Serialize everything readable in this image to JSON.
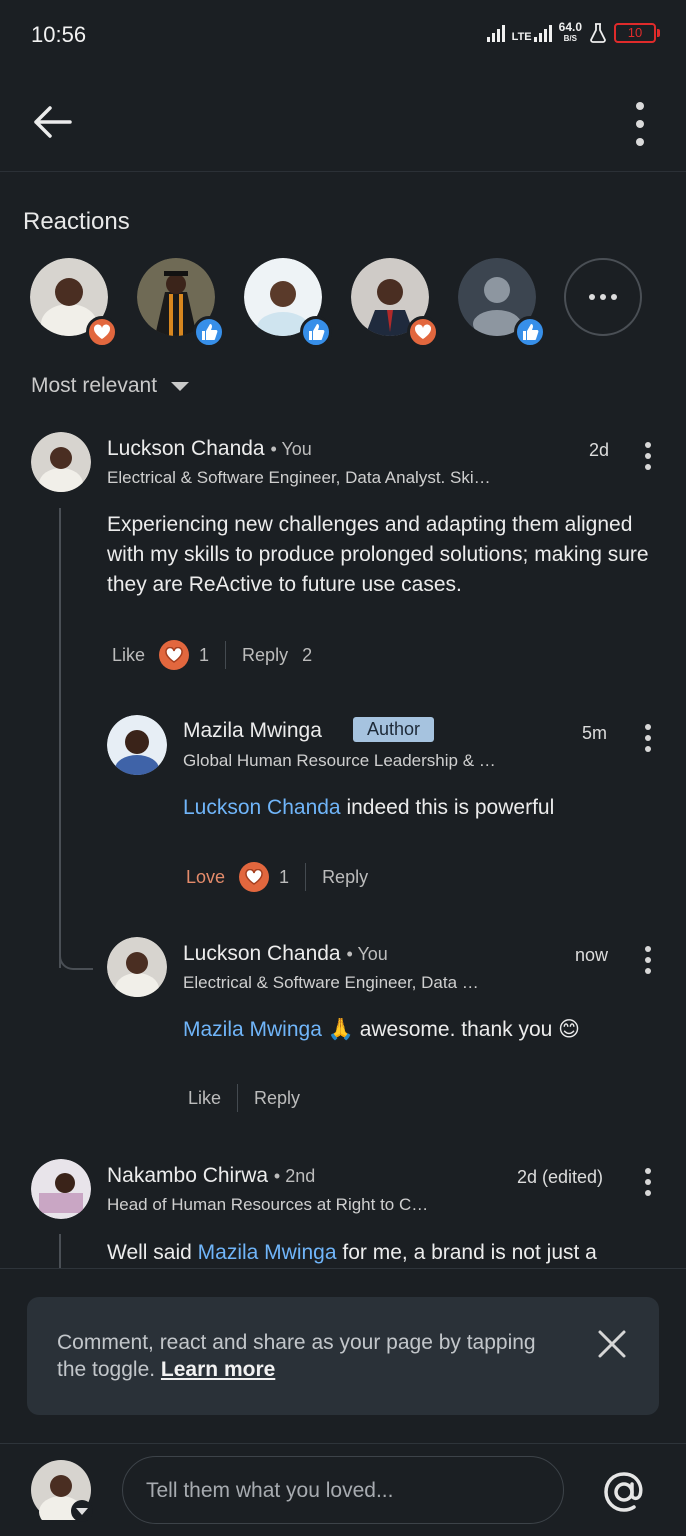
{
  "status": {
    "time": "10:56",
    "network": "LTE",
    "speed_value": "64.0",
    "speed_unit": "B/S",
    "battery": "10"
  },
  "reactions": {
    "title": "Reactions",
    "reactors": [
      {
        "reaction": "love"
      },
      {
        "reaction": "like"
      },
      {
        "reaction": "like"
      },
      {
        "reaction": "love"
      },
      {
        "reaction": "like"
      }
    ]
  },
  "sort": {
    "label": "Most relevant"
  },
  "comments": [
    {
      "name": "Luckson Chanda",
      "degree": "• You",
      "headline": "Electrical & Software Engineer, Data Analyst. Ski…",
      "time": "2d",
      "text": "Experiencing new challenges and adapting them aligned with my skills to produce prolonged solutions; making sure they are ReActive to future use cases.",
      "like_label": "Like",
      "reaction_count": "1",
      "reply_label": "Reply",
      "reply_count": "2",
      "replies": [
        {
          "name": "Mazila Mwinga",
          "badge": "Author",
          "headline": "Global Human Resource Leadership & …",
          "time": "5m",
          "mention": "Luckson Chanda",
          "text": " indeed this is powerful",
          "like_label": "Love",
          "reaction_count": "1",
          "reply_label": "Reply"
        },
        {
          "name": "Luckson Chanda",
          "degree": "• You",
          "headline": "Electrical & Software Engineer, Data …",
          "time": "now",
          "mention": "Mazila Mwinga",
          "text": " 🙏 awesome. thank you 😊",
          "like_label": "Like",
          "reply_label": "Reply"
        }
      ]
    },
    {
      "name": "Nakambo Chirwa",
      "degree": "• 2nd",
      "headline": "Head of Human Resources at Right to C…",
      "time": "2d (edited)",
      "text_before": "Well said ",
      "mention": "Mazila Mwinga",
      "text_after": " for me, a brand is not just a"
    }
  ],
  "toast": {
    "text": "Comment, react and share as your page by tapping the toggle. ",
    "link": "Learn more"
  },
  "composer": {
    "placeholder": "Tell them what you loved..."
  },
  "colors": {
    "background": "#1b1f23",
    "mention": "#70b5f9",
    "love": "#e2673e",
    "like": "#378fe9",
    "author_badge": "#a6c3df"
  }
}
